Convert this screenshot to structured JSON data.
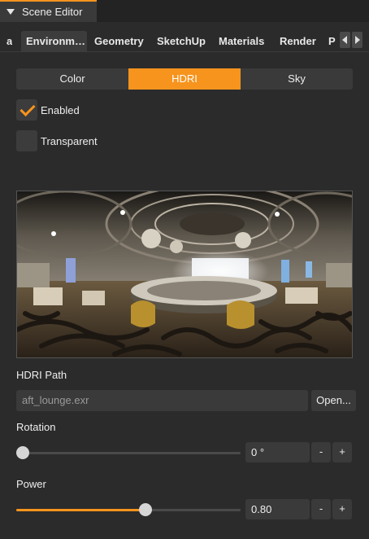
{
  "window": {
    "title": "Scene Editor",
    "collapse_icon": "triangle-down-icon"
  },
  "tabs": {
    "items": [
      {
        "label": "a"
      },
      {
        "label": "Environm…"
      },
      {
        "label": "Geometry"
      },
      {
        "label": "SketchUp"
      },
      {
        "label": "Materials"
      },
      {
        "label": "Render"
      },
      {
        "label": "P"
      }
    ],
    "active_index": 1,
    "scroll_left_icon": "arrow-left-icon",
    "scroll_right_icon": "arrow-right-icon"
  },
  "mode": {
    "options": [
      "Color",
      "HDRI",
      "Sky"
    ],
    "selected": "HDRI"
  },
  "options": {
    "enabled_label": "Enabled",
    "enabled_checked": true,
    "transparent_label": "Transparent",
    "transparent_checked": false
  },
  "hdri_path": {
    "label": "HDRI Path",
    "value": "aft_lounge.exr",
    "open_label": "Open..."
  },
  "rotation": {
    "label": "Rotation",
    "value": "0 °",
    "fraction": 0,
    "minus": "-",
    "plus": "+"
  },
  "power": {
    "label": "Power",
    "value": "0.80",
    "fraction": 0.58,
    "minus": "-",
    "plus": "+"
  },
  "colors": {
    "accent": "#f7941d",
    "panel": "#2b2b2b",
    "control": "#3a3a3a"
  }
}
